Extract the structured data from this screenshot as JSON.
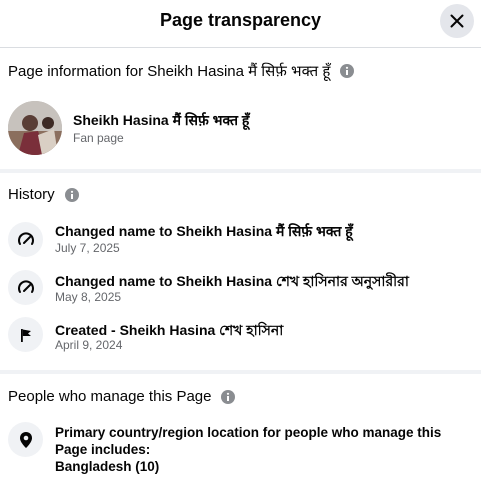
{
  "header": {
    "title": "Page transparency",
    "close_icon": "close-icon"
  },
  "page_info": {
    "heading": "Page information for Sheikh Hasina मैं सिर्फ़ भक्त हूँ",
    "name": "Sheikh Hasina मैं सिर्फ़ भक्त हूँ",
    "category": "Fan page",
    "avatar": "page-avatar"
  },
  "history": {
    "heading": "History",
    "items": [
      {
        "icon": "rename-icon",
        "title": "Changed name to Sheikh Hasina मैं सिर्फ़ भक्त हूँ",
        "date": "July 7, 2025"
      },
      {
        "icon": "rename-icon",
        "title": "Changed name to Sheikh Hasina শেখ হাসিনার অনুসারীরা",
        "date": "May 8, 2025"
      },
      {
        "icon": "flag-icon",
        "title": "Created - Sheikh Hasina শেখ হাসিনা",
        "date": "April 9, 2024"
      }
    ]
  },
  "managers": {
    "heading": "People who manage this Page",
    "location_label": "Primary country/region location for people who manage this Page includes:",
    "location_value": "Bangladesh (10)",
    "icon": "location-pin-icon"
  },
  "colors": {
    "divider": "#f0f2f5",
    "secondary_text": "#65676b",
    "icon_bg": "#e4e6eb"
  }
}
